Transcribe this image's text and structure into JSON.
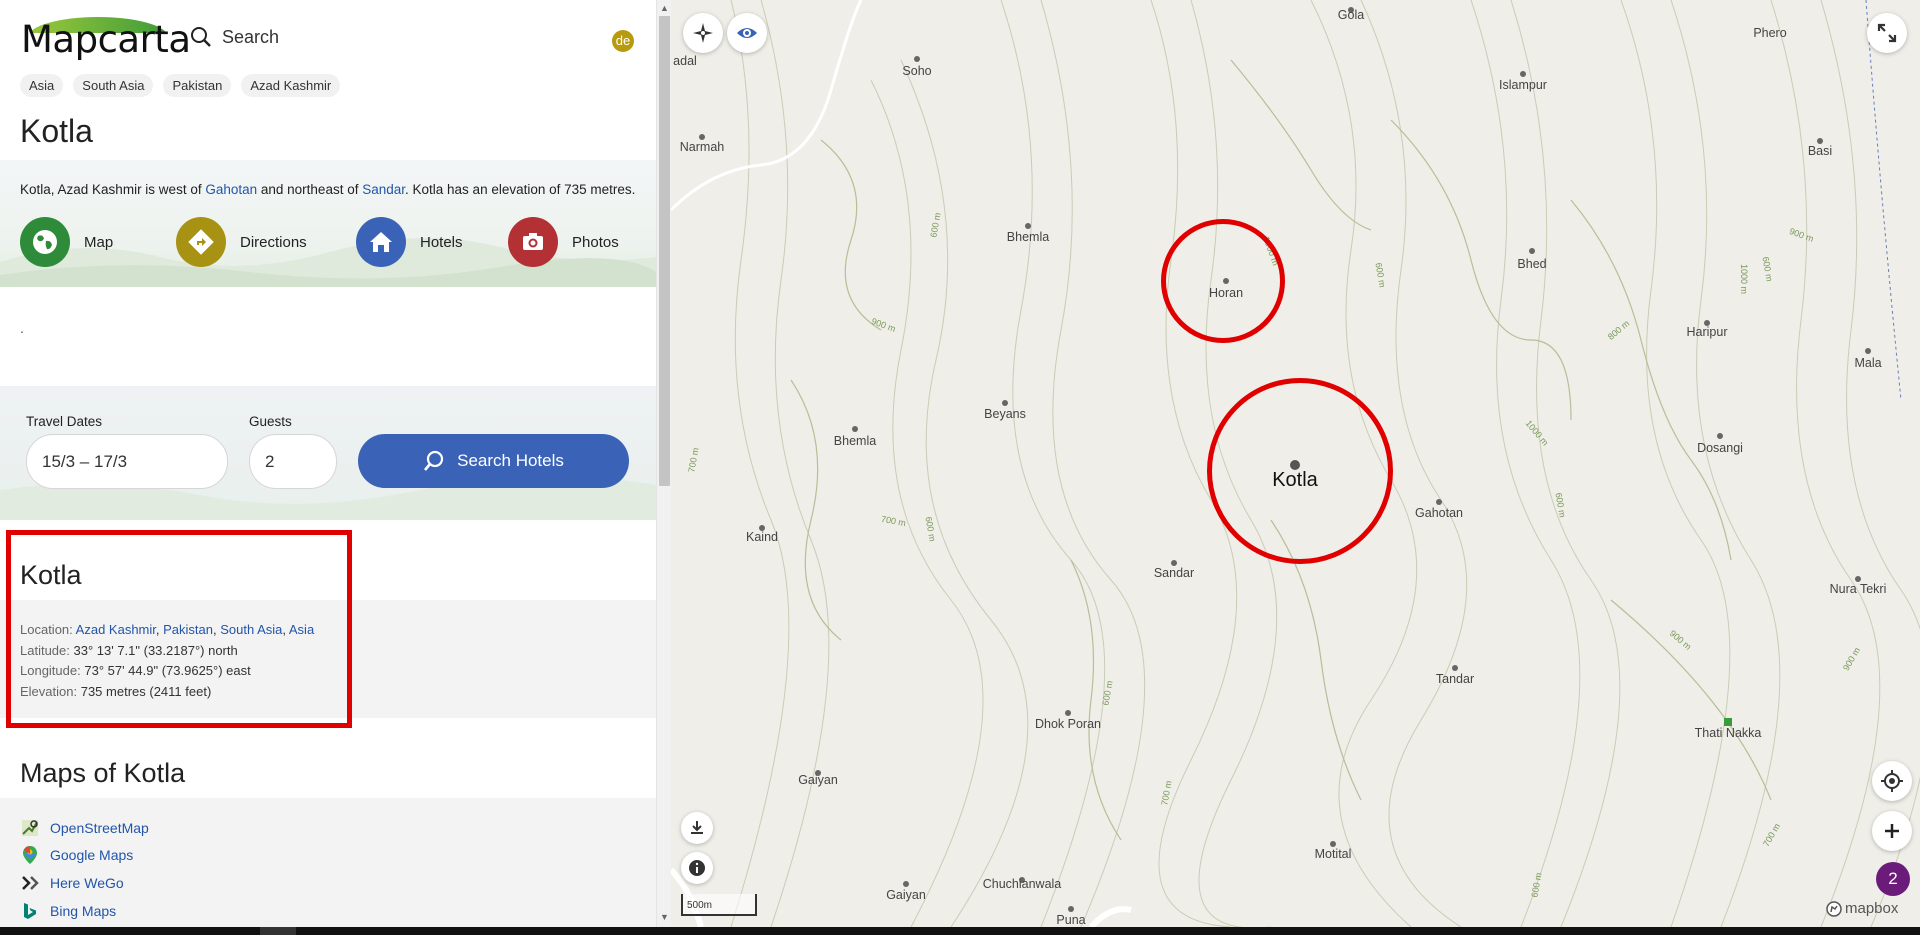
{
  "header": {
    "logo": "Mapcarta",
    "search_label": "Search",
    "lang": "de",
    "breadcrumbs": [
      "Asia",
      "South Asia",
      "Pakistan",
      "Azad Kashmir"
    ]
  },
  "title": "Kotla",
  "intro": {
    "prefix": "Kotla, Azad Kashmir is west of ",
    "link1": "Gahotan",
    "middle": " and northeast of ",
    "link2": "Sandar",
    "suffix": ". Kotla has an elevation of 735 metres."
  },
  "actions": [
    {
      "label": "Map",
      "color": "#2e8b3a",
      "icon": "globe-icon"
    },
    {
      "label": "Directions",
      "color": "#a89214",
      "icon": "directions-icon"
    },
    {
      "label": "Hotels",
      "color": "#3a63b8",
      "icon": "home-icon"
    },
    {
      "label": "Photos",
      "color": "#b33034",
      "icon": "camera-icon"
    }
  ],
  "dot_text": ".",
  "booking": {
    "dates_label": "Travel Dates",
    "dates_value": "15/3 – 17/3",
    "guests_label": "Guests",
    "guests_value": "2",
    "search_button": "Search Hotels"
  },
  "info": {
    "title": "Kotla",
    "location_key": "Location:",
    "location_links": [
      "Azad Kashmir",
      "Pakistan",
      "South Asia",
      "Asia"
    ],
    "latitude_key": "Latitude:",
    "latitude_value": "33° 13' 7.1\" (33.2187°) north",
    "longitude_key": "Longitude:",
    "longitude_value": "73° 57' 44.9\" (73.9625°) east",
    "elevation_key": "Elevation:",
    "elevation_value": "735 metres (2411 feet)"
  },
  "maps": {
    "title": "Maps of Kotla",
    "links": [
      "OpenStreetMap",
      "Google Maps",
      "Here WeGo",
      "Bing Maps"
    ]
  },
  "map": {
    "places": [
      "Gola",
      "Soho",
      "Phero",
      "Islampur",
      "Narmah",
      "Basi",
      "Bhemla",
      "Horan",
      "Bhed",
      "Haripur",
      "Mala",
      "Beyans",
      "Bhemla",
      "Dosangi",
      "Kotla",
      "Gahotan",
      "Kaind",
      "Sandar",
      "Nura Tekri",
      "Tandar",
      "Dhok Poran",
      "Thati Nakka",
      "Gaiyan",
      "Motital",
      "Chuchianwala",
      "Gaiyan",
      "Puna",
      "adal"
    ],
    "elevations": [
      "600 m",
      "700 m",
      "1000 m",
      "600 m",
      "900 m",
      "1000 m",
      "700 m",
      "600 m",
      "900 m",
      "900 m",
      "600 m",
      "1000 m",
      "600 m",
      "700 m",
      "700 m",
      "600 m",
      "800 m",
      "900 m",
      "600 m"
    ],
    "scale": "500m",
    "attribution": "mapbox",
    "badge_count": "2"
  }
}
